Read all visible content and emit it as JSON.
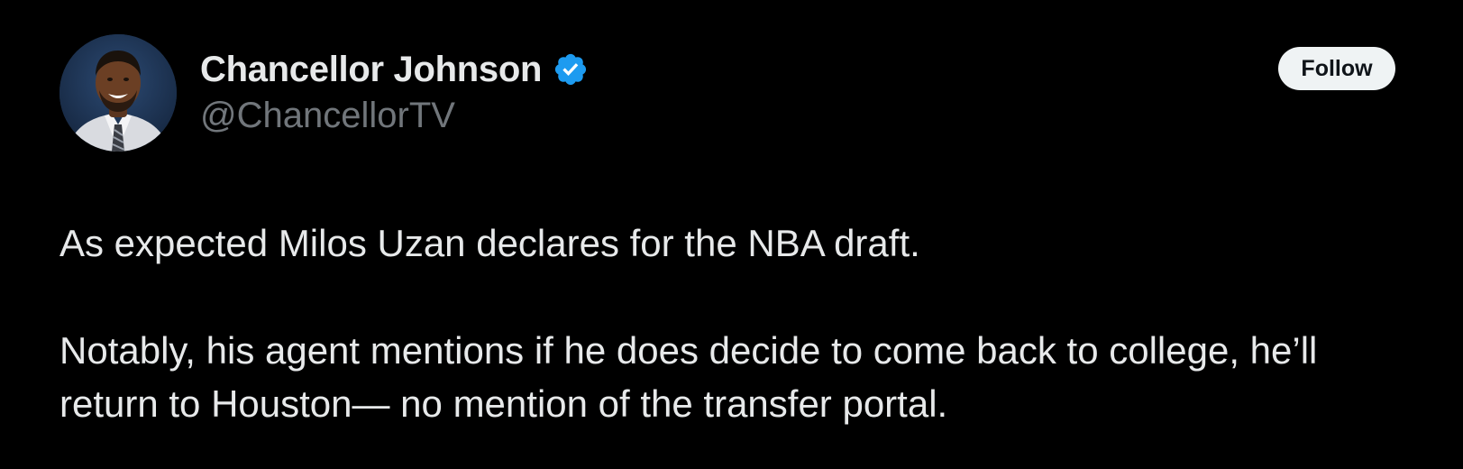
{
  "author": {
    "display_name": "Chancellor Johnson",
    "handle": "@ChancellorTV",
    "verified": true,
    "verified_icon": "verified-badge-icon",
    "verified_color": "#1d9bf0"
  },
  "actions": {
    "follow_label": "Follow"
  },
  "tweet": {
    "paragraphs": [
      "As expected Milos Uzan declares for the NBA draft.",
      "Notably, his agent mentions if he does decide to come back to college, he’ll return to Houston— no mention of the transfer portal."
    ]
  },
  "colors": {
    "background": "#000000",
    "primary_text": "#e7e9ea",
    "secondary_text": "#71767b",
    "follow_bg": "#eff3f4",
    "follow_text": "#0f1419"
  }
}
